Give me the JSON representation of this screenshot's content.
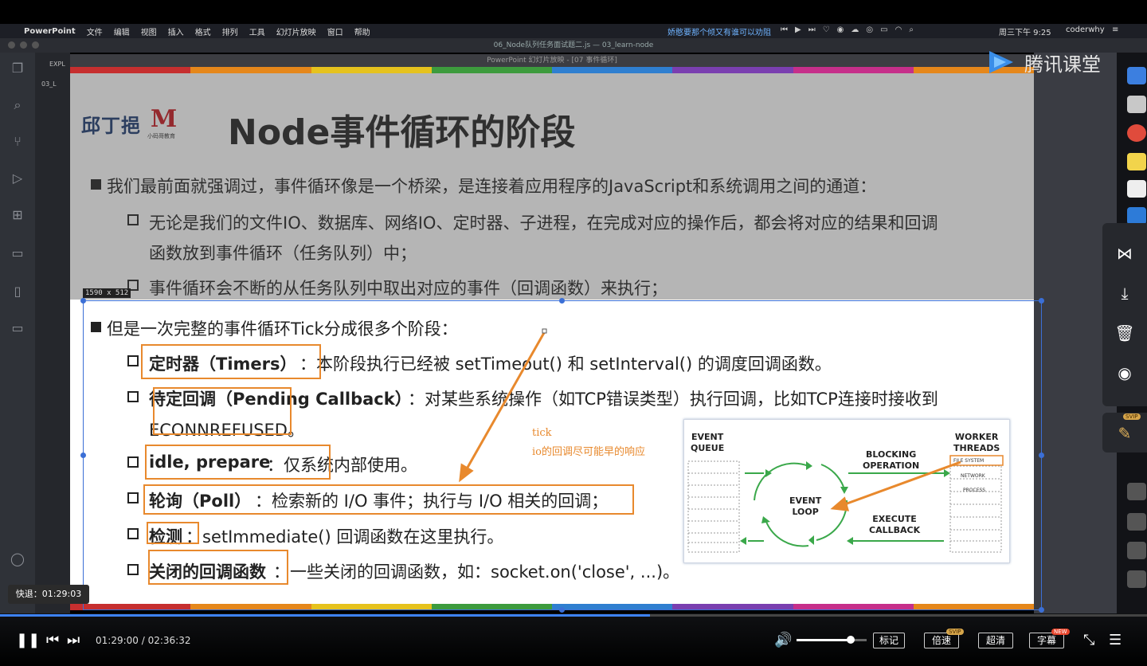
{
  "menubar": {
    "app": "PowerPoint",
    "menus": [
      "文件",
      "编辑",
      "视图",
      "插入",
      "格式",
      "排列",
      "工具",
      "幻灯片放映",
      "窗口",
      "帮助"
    ],
    "marquee": "娇憨要那个倾又有谁可以劝阻",
    "clock": "周三下午 9:25",
    "user": "coderwhy"
  },
  "vscode": {
    "title": "06_Node队列任务面试题二.js — 03_learn-node",
    "explorer_label": "EXPL",
    "folder": "03_L"
  },
  "powerpoint": {
    "title": "PowerPoint 幻灯片放映 - [07 事件循环]"
  },
  "slide": {
    "logo_left": "邱丁挹",
    "logo_right_mark": "M",
    "logo_right_text": "小码哥教育",
    "title": "Node事件循环的阶段",
    "p1": "我们最前面就强调过，事件循环像是一个桥梁，是连接着应用程序的JavaScript和系统调用之间的通道：",
    "p1a_line1": "无论是我们的文件IO、数据库、网络IO、定时器、子进程，在完成对应的操作后，都会将对应的结果和回调",
    "p1a_line2": "函数放到事件循环（任务队列）中；",
    "p1b": "事件循环会不断的从任务队列中取出对应的事件（回调函数）来执行；",
    "p2": "但是一次完整的事件循环Tick分成很多个阶段：",
    "phases": [
      {
        "name": "定时器（Timers）",
        "desc": "：本阶段执行已经被 setTimeout() 和 setInterval() 的调度回调函数。"
      },
      {
        "name": "待定回调（Pending Callback）",
        "desc": "：对某些系统操作（如TCP错误类型）执行回调，比如TCP连接时接收到",
        "desc2": "ECONNREFUSED。"
      },
      {
        "name": "idle, prepare",
        "desc": "：仅系统内部使用。"
      },
      {
        "name": "轮询（Poll）",
        "desc": "：检索新的 I/O 事件；执行与 I/O 相关的回调；"
      },
      {
        "name": "检测",
        "desc": "：setImmediate() 回调函数在这里执行。"
      },
      {
        "name": "关闭的回调函数",
        "desc": "：一些关闭的回调函数，如：socket.on('close', ...)。"
      }
    ],
    "dim_label": "1590 x 512",
    "annotation_line1": "tick",
    "annotation_line2": "io的回调尽可能早的响应"
  },
  "diagram": {
    "event_queue": [
      "EVENT",
      "QUEUE"
    ],
    "event_loop": [
      "EVENT",
      "LOOP"
    ],
    "blocking": [
      "BLOCKING",
      "OPERATION"
    ],
    "execute": [
      "EXECUTE",
      "CALLBACK"
    ],
    "workers": [
      "WORKER",
      "THREADS"
    ],
    "file_system": "FILE SYSTEM",
    "network": "NETWORK",
    "process": "PROCESS"
  },
  "tencent": {
    "brand": "腾讯课堂"
  },
  "sidepanel": {
    "svip": "SVIP"
  },
  "player": {
    "seek_tooltip": "快退：01:29:03",
    "current": "01:29:00",
    "sep": " / ",
    "duration": "02:36:32",
    "progress": 0.567,
    "volume": 0.77,
    "btn_mark": "标记",
    "btn_speed": "倍速",
    "btn_speed_tag": "SVIP",
    "btn_quality": "超清",
    "btn_subtitle": "字幕",
    "btn_subtitle_tag": "NEW"
  },
  "colors": {
    "accent_orange": "#e8892d",
    "loop_green": "#3aa84a",
    "progress_blue": "#3d82f5",
    "selection_blue": "#3b6fd6"
  }
}
